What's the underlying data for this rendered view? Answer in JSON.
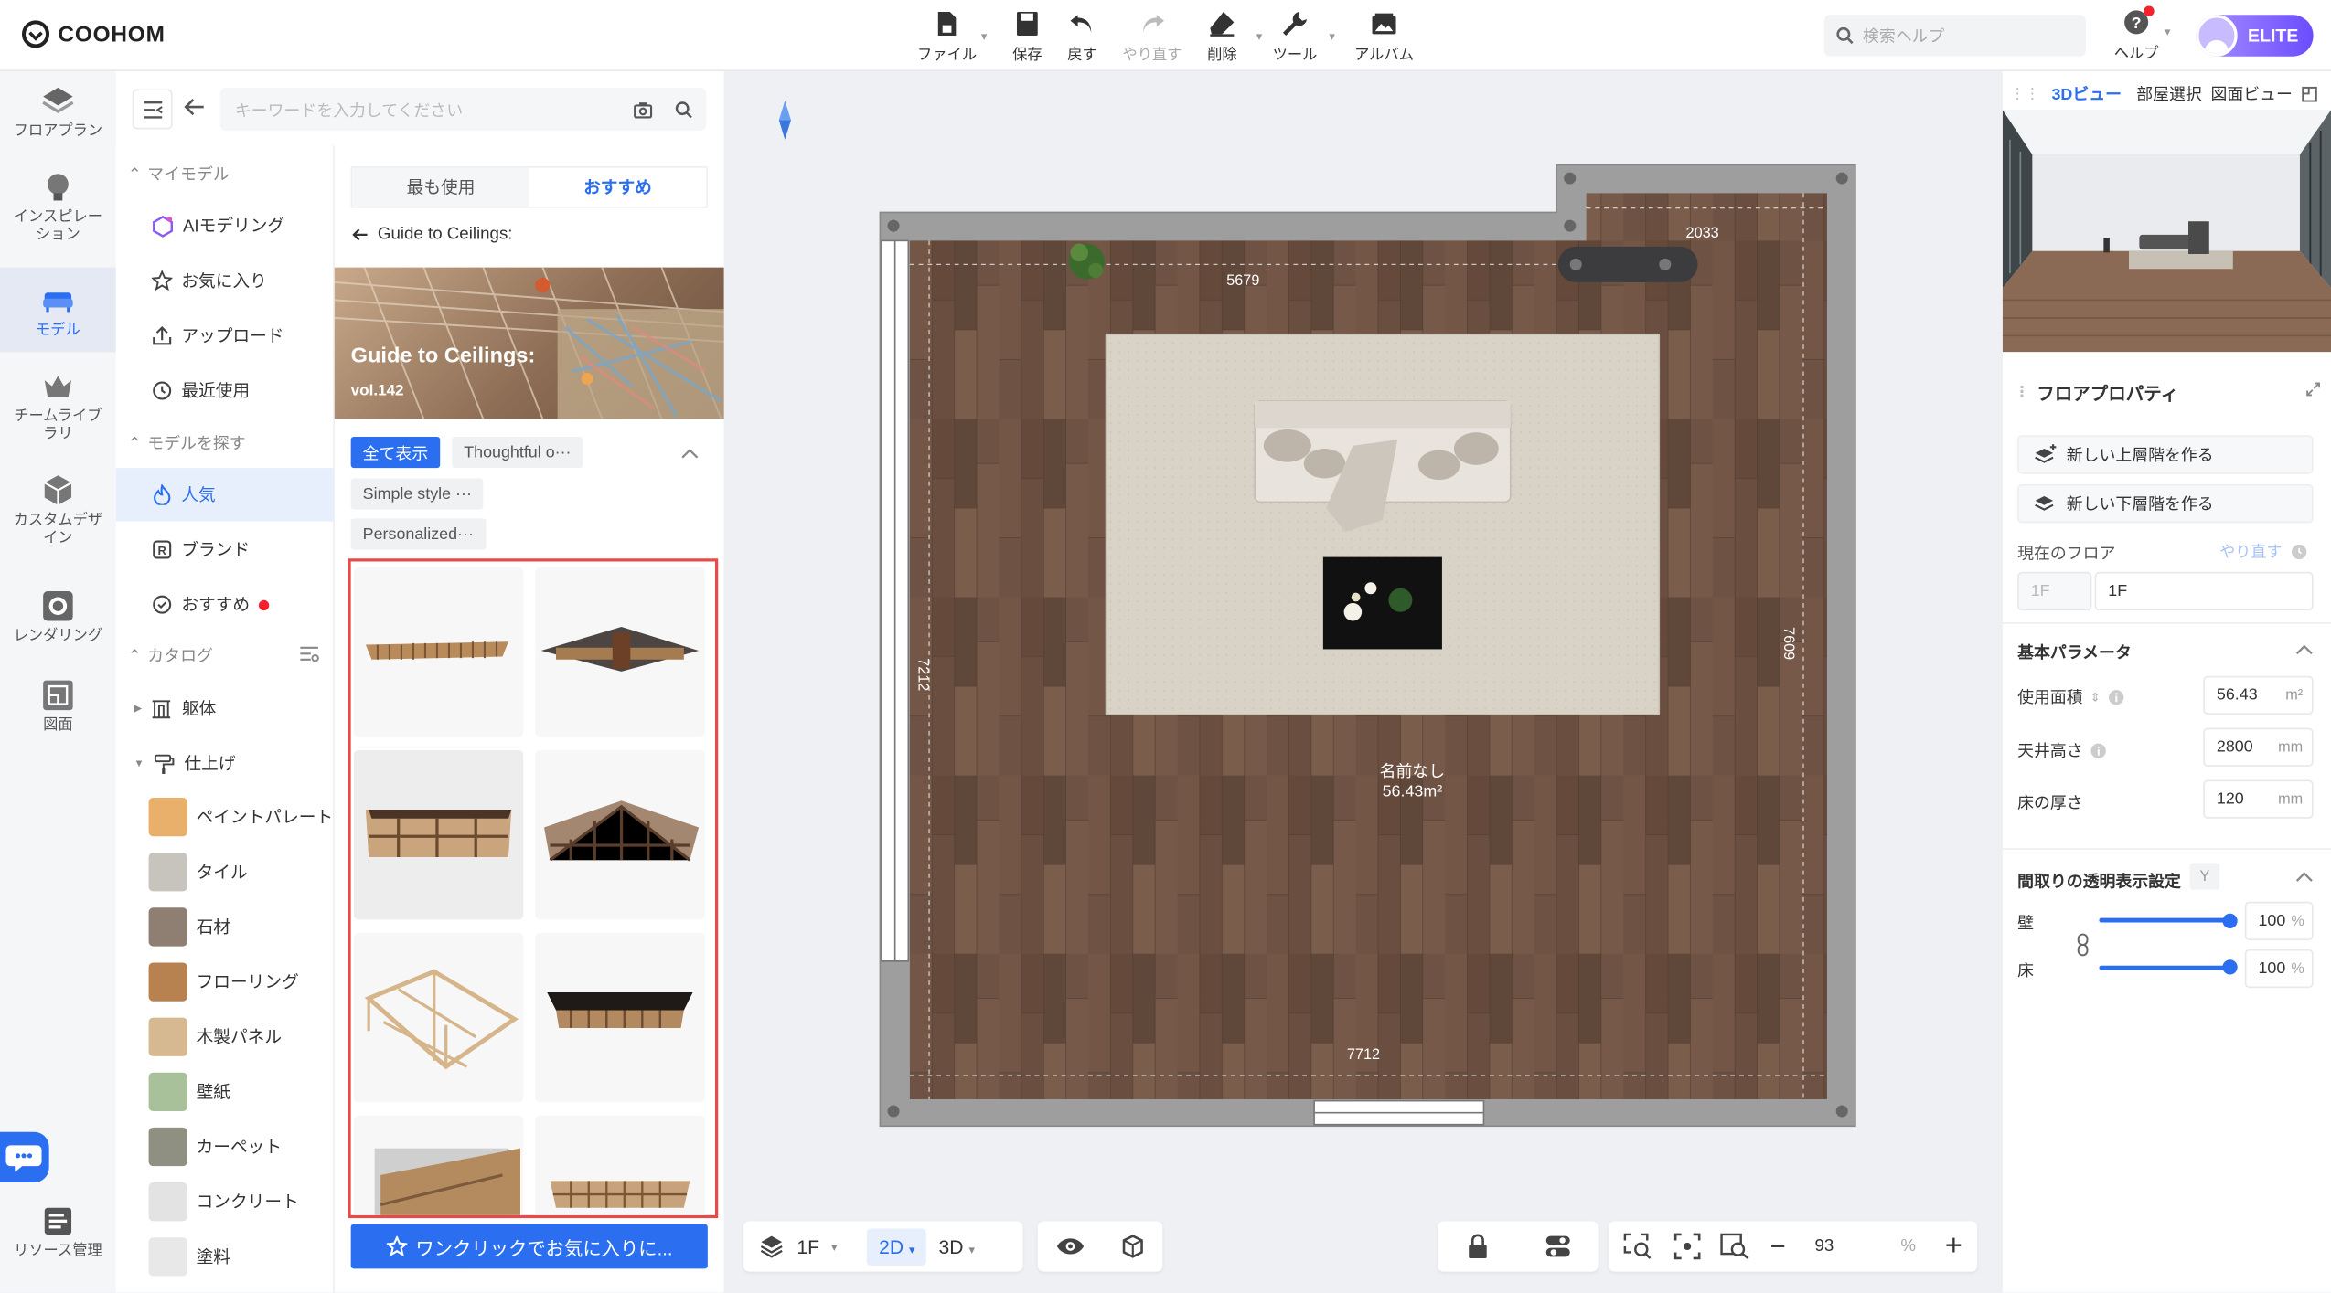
{
  "header": {
    "logo": "COOHOM",
    "toolbar": [
      {
        "label": "ファイル",
        "icon": "file-icon",
        "caret": true
      },
      {
        "label": "保存",
        "icon": "save-icon"
      },
      {
        "label": "戻す",
        "icon": "undo-icon"
      },
      {
        "label": "やり直す",
        "icon": "redo-icon",
        "disabled": true
      },
      {
        "label": "削除",
        "icon": "eraser-icon",
        "caret": true
      },
      {
        "label": "ツール",
        "icon": "wrench-icon",
        "caret": true
      },
      {
        "label": "アルバム",
        "icon": "album-icon"
      }
    ],
    "search_placeholder": "検索ヘルプ",
    "help_label": "ヘルプ",
    "badge": "ELITE"
  },
  "rail": [
    {
      "label": "フロアプラン",
      "icon": "floorplan-icon"
    },
    {
      "label": "インスピレーション",
      "icon": "lightbulb-icon"
    },
    {
      "label": "モデル",
      "icon": "sofa-icon",
      "active": true
    },
    {
      "label": "チームライブラリ",
      "icon": "crown-icon"
    },
    {
      "label": "カスタムデザイン",
      "icon": "box-icon"
    },
    {
      "label": "レンダリング",
      "icon": "camera-icon"
    },
    {
      "label": "図面",
      "icon": "drawing-icon"
    },
    {
      "label": "リソース管理",
      "icon": "resource-icon"
    }
  ],
  "library": {
    "search_placeholder": "キーワードを入力してください",
    "my_models_header": "マイモデル",
    "my_models": [
      "AIモデリング",
      "お気に入り",
      "アップロード",
      "最近使用"
    ],
    "find_header": "モデルを探す",
    "find": [
      {
        "label": "人気",
        "active": true
      },
      {
        "label": "ブランド"
      },
      {
        "label": "おすすめ",
        "dot": true
      }
    ],
    "catalog_header": "カタログ",
    "catalog_groups": [
      "躯体",
      "仕上げ"
    ],
    "materials": [
      {
        "label": "ペイントパレート",
        "color": "#e8b06a"
      },
      {
        "label": "タイル",
        "color": "#c7c3bd"
      },
      {
        "label": "石材",
        "color": "#8f7f72"
      },
      {
        "label": "フローリング",
        "color": "#b7824f"
      },
      {
        "label": "木製パネル",
        "color": "#d7b991"
      },
      {
        "label": "壁紙",
        "color": "#a8c19a"
      },
      {
        "label": "カーペット",
        "color": "#8f8f82"
      },
      {
        "label": "コンクリート",
        "color": "#e3e3e3"
      },
      {
        "label": "塗料",
        "color": "#e8e8e8"
      }
    ],
    "tabs": [
      "最も使用",
      "おすすめ"
    ],
    "active_tab": "おすすめ",
    "back_label": "Guide to Ceilings:",
    "banner_title": "Guide to Ceilings:",
    "banner_sub": "vol.142",
    "filters": [
      "全て表示",
      "Thoughtful o···",
      "Simple style ···",
      "Personalized···"
    ],
    "fav_button": "ワンクリックでお気に入りに..."
  },
  "plan": {
    "room_name": "名前なし",
    "room_area": "56.43m²",
    "dims": {
      "top": "5679",
      "top_right": "2033",
      "left": "7212",
      "right": "7609",
      "bottom": "7712"
    }
  },
  "bottom_bar": {
    "floor": "1F",
    "mode_2d": "2D",
    "mode_3d": "3D",
    "zoom": "93",
    "zoom_unit": "%"
  },
  "right_panel": {
    "tabs": [
      "3Dビュー",
      "部屋選択",
      "図面ビュー"
    ],
    "title": "フロアプロパティ",
    "btn_up": "新しい上層階を作る",
    "btn_down": "新しい下層階を作る",
    "current_floor_label": "現在のフロア",
    "redo_label": "やり直す",
    "floor_prefix": "1F",
    "floor_value": "1F",
    "basic_params": "基本パラメータ",
    "area_label": "使用面積",
    "area_value": "56.43",
    "area_unit": "m²",
    "ceiling_label": "天井高さ",
    "ceiling_value": "2800",
    "ceiling_unit": "mm",
    "floor_thick_label": "床の厚さ",
    "floor_thick_value": "120",
    "floor_thick_unit": "mm",
    "transparency_title": "間取りの透明表示設定",
    "transparency_key": "Y",
    "wall_label": "壁",
    "wall_value": "100",
    "floor_label": "床",
    "floor_value2": "100",
    "pct": "%"
  }
}
